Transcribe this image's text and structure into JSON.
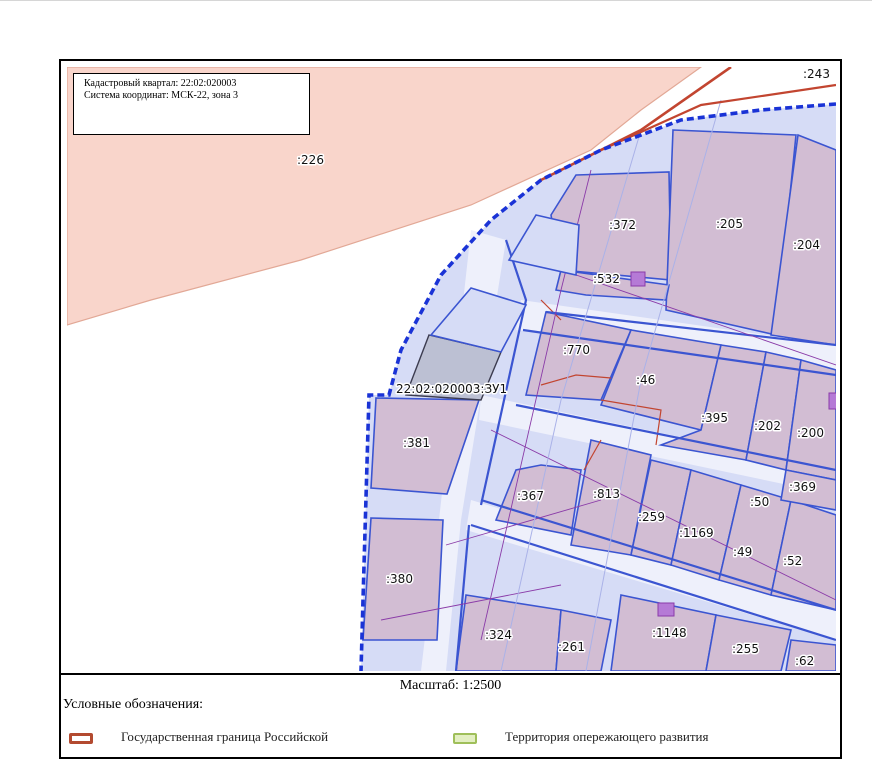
{
  "info": {
    "quarter": "Кадастровый квартал: 22:02:020003",
    "coords": "Система координат: МСК-22, зона 3"
  },
  "scale": "Масштаб: 1:2500",
  "legend": {
    "title": "Условные обозначения:",
    "items": [
      {
        "label": "Государственная граница Российской",
        "color": "#b34a30"
      },
      {
        "label": "Территория опережающего развития",
        "color": "#c5dc8a"
      }
    ]
  },
  "colors": {
    "outer_parcel_fill": "#f9d5cb",
    "parcel_fill": "#d2bdd3",
    "quarter_fill": "#d6dcf6",
    "quarter_border": "#3b55d1",
    "boundary_dashed": "#1a33d6",
    "red_line": "#c24530",
    "new_parcel_fill": "#bcc0d3"
  },
  "map_labels": {
    "p226": ":226",
    "p243": ":243",
    "p372": ":372",
    "p205": ":205",
    "p204": ":204",
    "p532": ":532",
    "p770": ":770",
    "p46": ":46",
    "zu1": "22:02:020003:ЗУ1",
    "p381": ":381",
    "p395": ":395",
    "p202": ":202",
    "p200": ":200",
    "p367": ":367",
    "p813": ":813",
    "p369": ":369",
    "p50": ":50",
    "p259": ":259",
    "p1169": ":1169",
    "p49": ":49",
    "p52": ":52",
    "p380": ":380",
    "p324": ":324",
    "p261": ":261",
    "p1148": ":1148",
    "p255": ":255",
    "p62": ":62"
  }
}
